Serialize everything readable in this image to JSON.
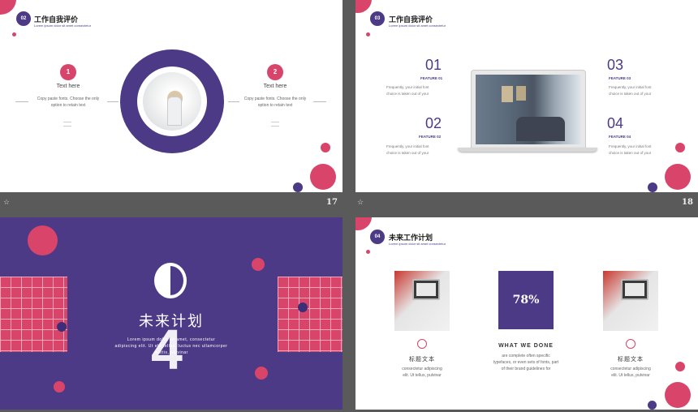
{
  "slide17": {
    "badge": "02",
    "title": "工作自我评价",
    "subtitle": "Lorem ipsum dolor sit amet consectetur",
    "item1": {
      "num": "1",
      "heading": "Text here",
      "desc1": "Copy paste fonts. Choose the only",
      "desc2": "option to retain text"
    },
    "item2": {
      "num": "2",
      "heading": "Text here",
      "desc1": "Copy paste fonts. Choose the only",
      "desc2": "option to retain text"
    },
    "page": "17"
  },
  "slide18": {
    "badge": "03",
    "title": "工作自我评价",
    "subtitle": "Lorem ipsum dolor sit amet consectetur",
    "features": [
      {
        "num": "01",
        "label": "FEATURE 01",
        "desc1": "Frequently, your initial font",
        "desc2": "choice is taken out of your"
      },
      {
        "num": "02",
        "label": "FEATURE 02",
        "desc1": "Frequently, your initial font",
        "desc2": "choice is taken out of your"
      },
      {
        "num": "03",
        "label": "FEATURE 03",
        "desc1": "Frequently, your initial font",
        "desc2": "choice is taken out of your"
      },
      {
        "num": "04",
        "label": "FEATURE 04",
        "desc1": "Frequently, your initial font",
        "desc2": "choice is taken out of your"
      }
    ],
    "page": "18"
  },
  "slide19": {
    "big_number": "4",
    "title": "未来计划",
    "body1": "Lorem ipsum dolor sit amet, consectetur",
    "body2": "adipiscing elit. Ut elit tellus, luctus nec ullamcorper",
    "body3": "mattis, pulvinar"
  },
  "slide20": {
    "badge": "04",
    "title": "未来工作计划",
    "subtitle": "Lorem ipsum dolor sit amet consectetur",
    "percent": "78%",
    "col1": {
      "heading": "标题文本",
      "desc1": "consectetur adipiscing",
      "desc2": "elit. Ut tellus, pulvinar"
    },
    "col2": {
      "heading": "WHAT WE DONE",
      "desc1": "are complete often specific",
      "desc2": "typefaces, or even sets of fonts, part",
      "desc3": "of their brand guidelines for"
    },
    "col3": {
      "heading": "标题文本",
      "desc1": "consectetur adipiscing",
      "desc2": "elit. Ut tellus, pulvinar"
    }
  },
  "colors": {
    "accent": "#d9456a",
    "brand": "#4c3a86",
    "frame": "#5a5a5a"
  }
}
